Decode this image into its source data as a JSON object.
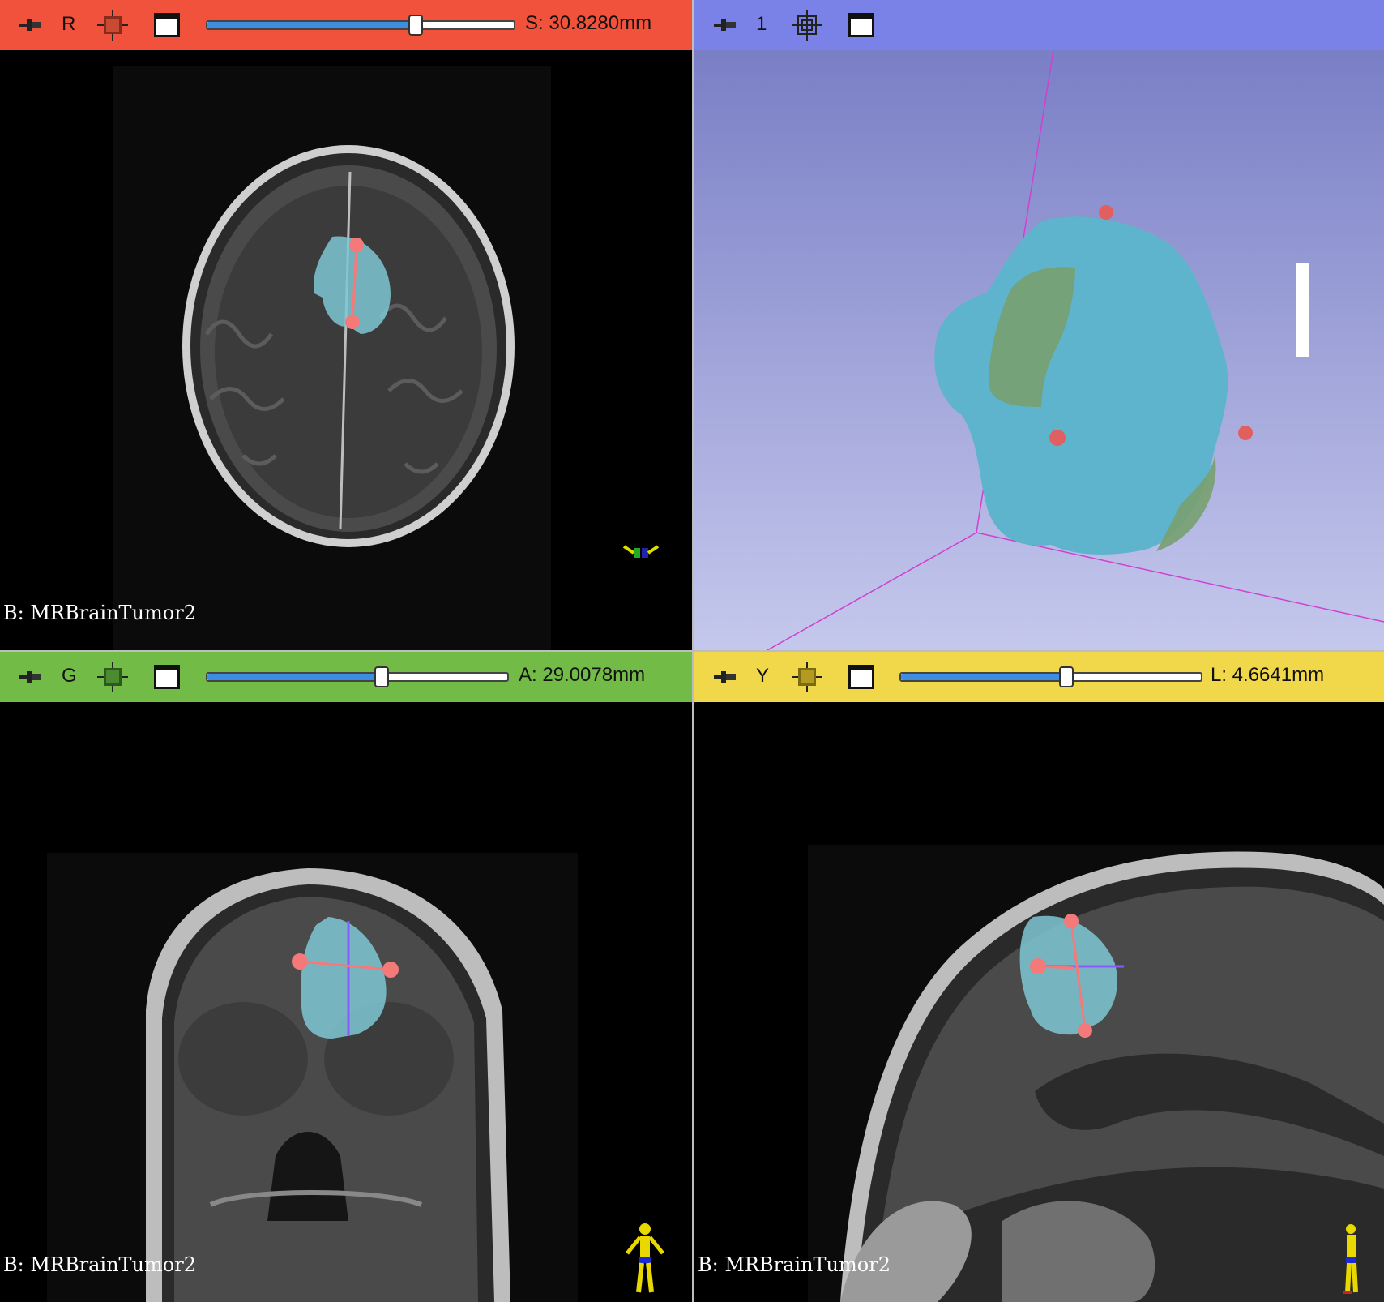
{
  "views": {
    "red": {
      "label": "R",
      "offset": "S: 30.8280mm",
      "slider_fraction": 0.68,
      "volume": "B: MRBrainTumor2",
      "color": "#f0523c"
    },
    "blue": {
      "label": "1",
      "color": "#7a82e8"
    },
    "green": {
      "label": "G",
      "offset": "A: 29.0078mm",
      "slider_fraction": 0.58,
      "volume": "B: MRBrainTumor2",
      "color": "#72bb46"
    },
    "yellow": {
      "label": "Y",
      "offset": "L: 4.6641mm",
      "slider_fraction": 0.55,
      "volume": "B: MRBrainTumor2",
      "color": "#f1d84a"
    }
  },
  "icons": {
    "pin": "pin-icon",
    "link": "link-icon",
    "maximize": "maximize-view-icon",
    "orientation": "orientation-marker-icon"
  },
  "colors": {
    "segmentation": "#7ec8d4",
    "markup": "#f47a7a",
    "model": "#5db4cc"
  }
}
